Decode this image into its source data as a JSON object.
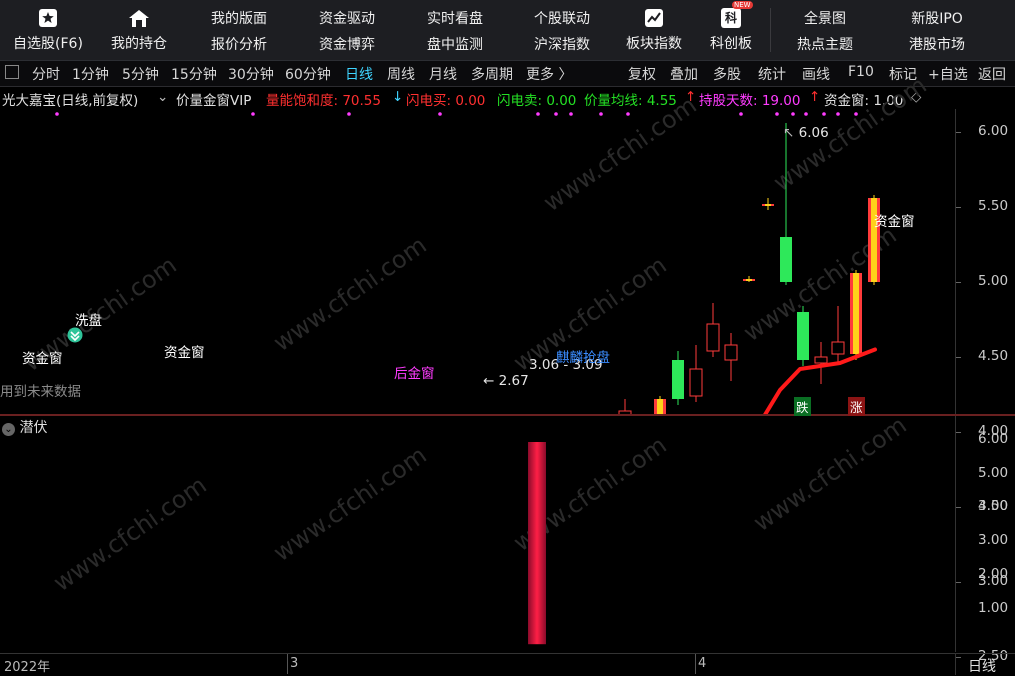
{
  "top_nav": {
    "zixuan": "自选股(F6)",
    "chicang": "我的持仓",
    "col1": [
      "我的版面",
      "报价分析"
    ],
    "col2": [
      "资金驱动",
      "资金博弈"
    ],
    "col3": [
      "实时看盘",
      "盘中监测"
    ],
    "col4": [
      "个股联动",
      "沪深指数"
    ],
    "bankuai": "板块指数",
    "kechuang": "科创板",
    "kechuang_icon": "科",
    "new_badge": "NEW",
    "col5": [
      "全景图",
      "热点主题"
    ],
    "col6": [
      "新股IPO",
      "港股市场"
    ]
  },
  "periods": [
    "分时",
    "1分钟",
    "5分钟",
    "15分钟",
    "30分钟",
    "60分钟",
    "日线",
    "周线",
    "月线",
    "多周期",
    "更多 〉"
  ],
  "active_period": "日线",
  "right_tools": [
    "复权",
    "叠加",
    "多股",
    "统计",
    "画线",
    "F10",
    "标记",
    "+自选",
    "返回"
  ],
  "indicator_bar": {
    "stock": "光大嘉宝(日线,前复权)",
    "indicator": "价量金窗VIP",
    "liang": "量能饱和度: 70.55",
    "liang_arrow": "↓",
    "sd_buy": "闪电买: 0.00",
    "sd_sell": "闪电卖: 0.00",
    "avg": "价量均线: 4.55",
    "avg_arrow": "↑",
    "days": "持股天数: 19.00",
    "days_arrow": "↑",
    "win": "资金窗: 1.00"
  },
  "main_axis": [
    "6.00",
    "5.50",
    "5.00",
    "4.50",
    "4.00",
    "3.50",
    "3.00",
    "2.50"
  ],
  "sub_axis": [
    "6.00",
    "5.00",
    "4.00",
    "3.00",
    "2.00",
    "1.00"
  ],
  "annotations": {
    "max": "6.06",
    "min": "← 2.67",
    "range": "3.06 - 3.09",
    "jl": "麒麟抢盘",
    "xipan": "洗盘",
    "zjc1": "资金窗",
    "zjc2": "资金窗",
    "zjc3": "资金窗",
    "hjc": "后金窗",
    "future": "用到未来数据",
    "die": "跌",
    "zhang": "涨"
  },
  "sub_title": "潜伏",
  "sub_bar_value": 6.0,
  "x_labels": [
    "2022年",
    "3",
    "4"
  ],
  "bottom_period": "日线",
  "watermark": "www.cfchi.com",
  "colors": {
    "up": "#ff3b3b",
    "down": "#3ff3ff",
    "ma_red": "#ff1a1a",
    "ma_green": "#24e024",
    "yellow": "#ffd21a"
  }
}
